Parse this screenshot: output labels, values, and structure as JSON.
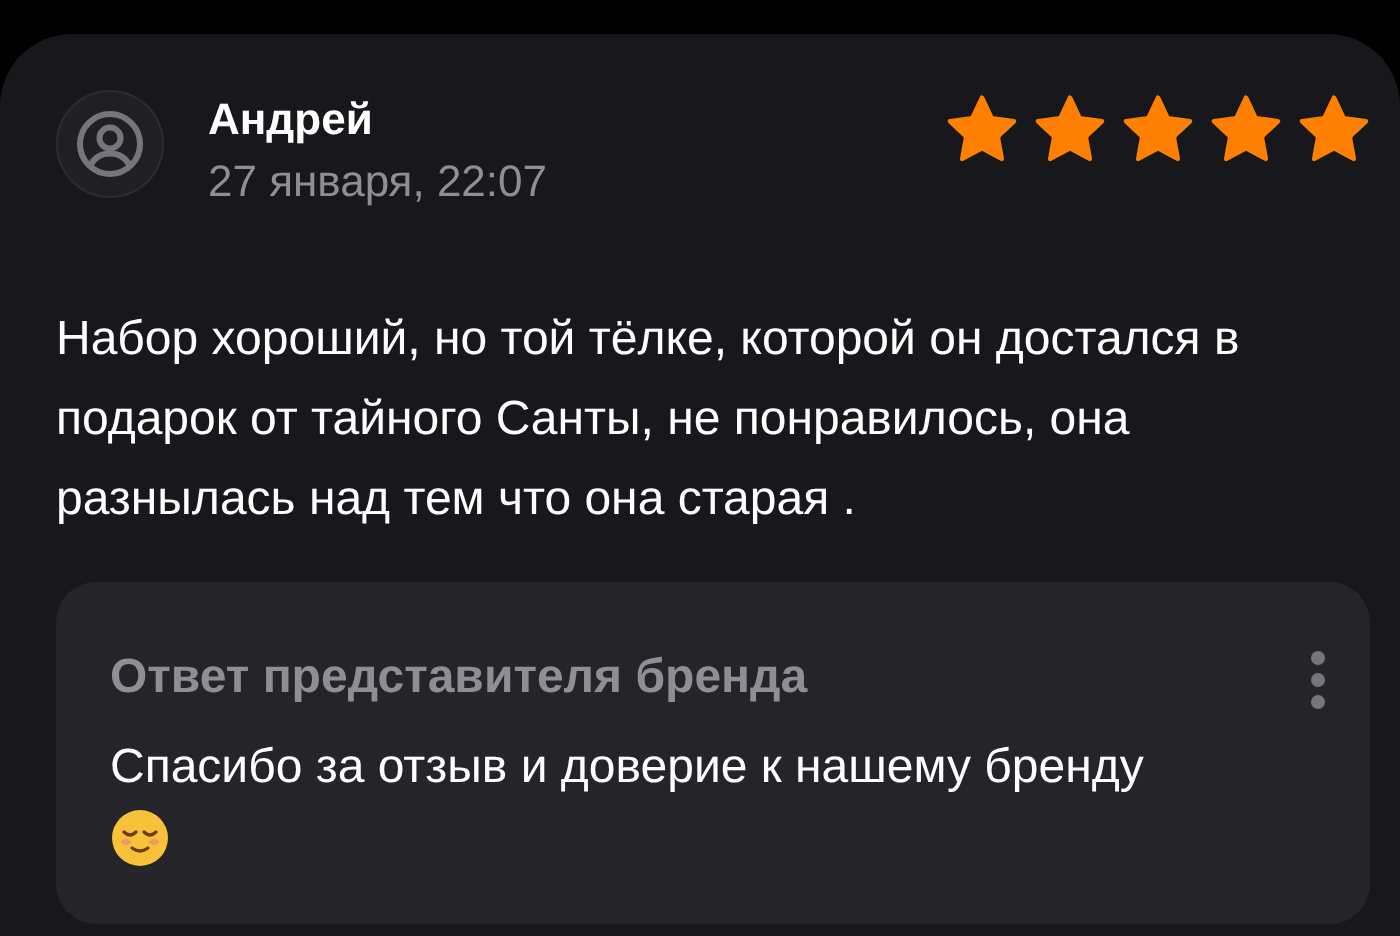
{
  "review": {
    "author": "Андрей",
    "date": "27 января, 22:07",
    "stars": 5,
    "text": "Набор хороший, но той тёлке, которой он достался в подарок от тайного Санты, не понравилось, она разнылась над тем что она старая ."
  },
  "reply": {
    "title": "Ответ представителя бренда",
    "text": "Спасибо за отзыв и доверие к нашему бренду"
  }
}
